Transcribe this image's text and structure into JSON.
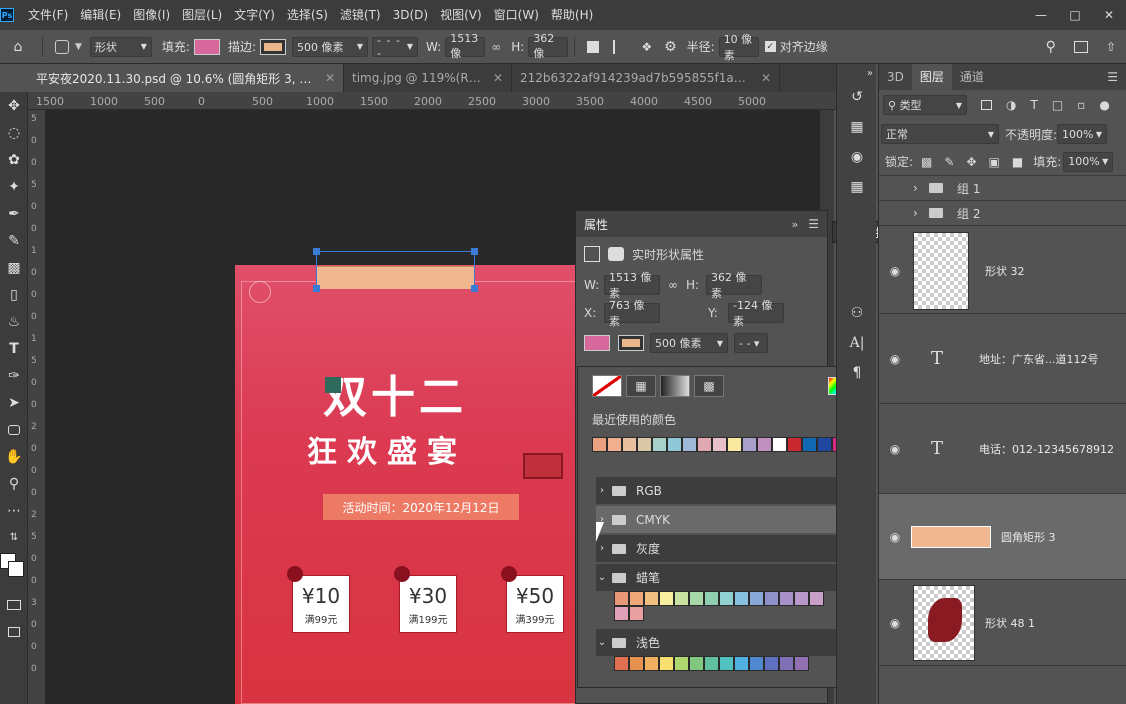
{
  "menubar": {
    "logo": "Ps",
    "items": [
      "文件(F)",
      "编辑(E)",
      "图像(I)",
      "图层(L)",
      "文字(Y)",
      "选择(S)",
      "滤镜(T)",
      "3D(D)",
      "视图(V)",
      "窗口(W)",
      "帮助(H)"
    ],
    "controls": [
      "minimize-icon",
      "maximize-icon",
      "close-icon"
    ]
  },
  "options": {
    "shape_mode": "形状",
    "fill_label": "填充:",
    "fill_color": "#d7689c",
    "stroke_label": "描边:",
    "stroke_color": "#e8b88c",
    "stroke_width": "500 像素",
    "w_label": "W:",
    "w_value": "1513 像",
    "h_label": "H:",
    "h_value": "362 像",
    "radius_label": "半径:",
    "radius_value": "10 像素",
    "align_edges": "对齐边缘"
  },
  "tabs": [
    {
      "label": "平安夜2020.11.30.psd @ 10.6% (圆角矩形 3, RGB/8) *",
      "active": true
    },
    {
      "label": "timg.jpg @ 119%(RGB/...",
      "active": false
    },
    {
      "label": "212b6322af914239ad7b595855f1ae43.jpg @...",
      "active": false
    }
  ],
  "ruler_top": [
    "1500",
    "1000",
    "500",
    "0",
    "500",
    "1000",
    "1500",
    "2000",
    "2500",
    "3000",
    "3500",
    "4000",
    "4500",
    "5000"
  ],
  "ruler_left": [
    "5",
    "0",
    "0",
    "5",
    "0",
    "0",
    "1",
    "0",
    "0",
    "0",
    "1",
    "5",
    "0",
    "0",
    "2",
    "0",
    "0",
    "0",
    "2",
    "5",
    "0",
    "0",
    "3",
    "0",
    "0",
    "0"
  ],
  "poster": {
    "title1": "双十二",
    "title2": "狂欢盛宴",
    "date_badge": "活动时间：2020年12月12日",
    "coupons": [
      {
        "amount": "¥10",
        "cond": "满99元"
      },
      {
        "amount": "¥30",
        "cond": "满199元"
      },
      {
        "amount": "¥50",
        "cond": "满399元"
      }
    ]
  },
  "properties": {
    "title": "属性",
    "float_label": "属性",
    "shape_props": "实时形状属性",
    "w_label": "W:",
    "w_value": "1513 像素",
    "h_label": "H:",
    "h_value": "362 像素",
    "x_label": "X:",
    "x_value": "763 像素",
    "y_label": "Y:",
    "y_value": "-124 像素",
    "stroke_width": "500 像素"
  },
  "color_popup": {
    "recent_label": "最近使用的颜色",
    "recent_colors": [
      "#e8a080",
      "#f0b090",
      "#e8c0a0",
      "#d8c8a8",
      "#a8d0c8",
      "#90c8d8",
      "#a0b8d8",
      "#e0a8b0",
      "#e8c0c8",
      "#f8e8a0",
      "#a8a0c8",
      "#c090c0",
      "#ffffff",
      "#c82830",
      "#1068b0",
      "#2048a0",
      "#d82888"
    ],
    "folders": [
      {
        "label": "RGB",
        "open": false
      },
      {
        "label": "CMYK",
        "open": false
      },
      {
        "label": "灰度",
        "open": false
      },
      {
        "label": "蜡笔",
        "open": true
      },
      {
        "label": "浅色",
        "open": true
      }
    ],
    "crayon_colors": [
      "#e89878",
      "#f0a878",
      "#f0c080",
      "#f8f0a0",
      "#c8e0a0",
      "#a8d8a8",
      "#90d0b0",
      "#90d0d0",
      "#88c0e0",
      "#88a8d8",
      "#9090c8",
      "#a890c8",
      "#b898c8",
      "#c8a0c8",
      "#e0a0b8",
      "#e8a0a0"
    ],
    "light_colors": [
      "#e07050",
      "#e89050",
      "#f0b060",
      "#f8e070",
      "#b0d870",
      "#80c880",
      "#60c0a0",
      "#50c0c0",
      "#50b0e0",
      "#5088d0",
      "#6070c0",
      "#8070b8",
      "#9070b0"
    ]
  },
  "layers": {
    "tabs": [
      "3D",
      "图层",
      "通道"
    ],
    "filter_kind": "类型",
    "blend_mode": "正常",
    "opacity_label": "不透明度:",
    "opacity_value": "100%",
    "lock_label": "锁定:",
    "fill_label": "填充:",
    "fill_value": "100%",
    "groups": [
      "组 1",
      "组 2"
    ],
    "items": [
      {
        "name": "形状 32",
        "type": "shape"
      },
      {
        "name": "地址：广东省...道112号",
        "type": "text"
      },
      {
        "name": "电话：012-12345678912",
        "type": "text"
      },
      {
        "name": "圆角矩形 3",
        "type": "rect",
        "selected": true
      },
      {
        "name": "形状 48 1",
        "type": "flower"
      }
    ]
  }
}
